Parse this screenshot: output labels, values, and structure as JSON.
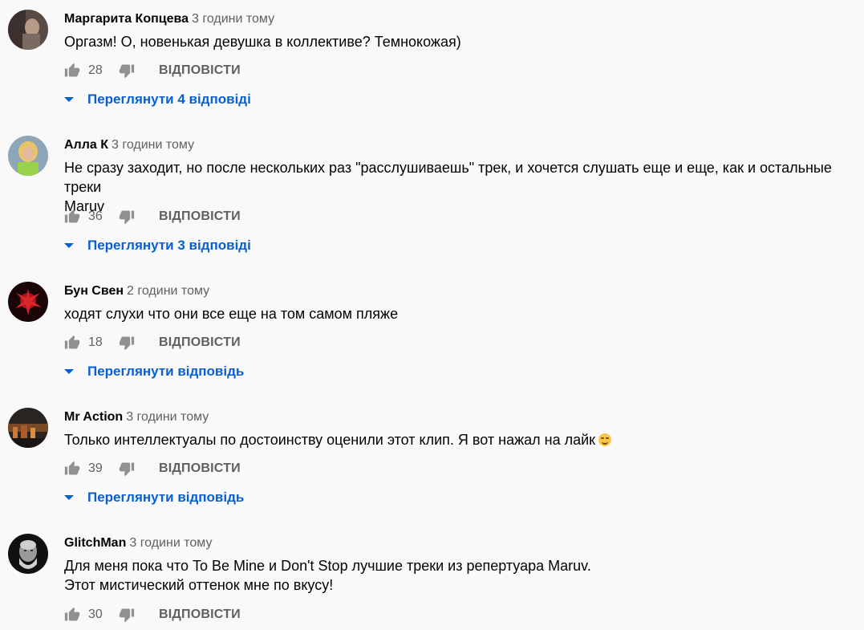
{
  "comments": [
    {
      "author": "Маргарита Копцева",
      "time": "3 години тому",
      "text_lines": [
        "Оргазм! О, новенькая девушка в коллективе? Темнокожая)"
      ],
      "likes": "28",
      "reply_label": "ВІДПОВІСТИ",
      "view_replies": "Переглянути 4 відповіді"
    },
    {
      "author": "Алла К",
      "time": "3 години тому",
      "text_lines": [
        "Не сразу заходит, но после нескольких раз \"расслушиваешь\" трек, и хочется слушать еще и еще, как и остальные треки",
        "Maruv"
      ],
      "likes": "36",
      "reply_label": "ВІДПОВІСТИ",
      "view_replies": "Переглянути 3 відповіді"
    },
    {
      "author": "Бун Свен",
      "time": "2 години тому",
      "text_lines": [
        "ходят слухи что они все еще на том самом пляже"
      ],
      "likes": "18",
      "reply_label": "ВІДПОВІСТИ",
      "view_replies": "Переглянути відповідь"
    },
    {
      "author": "Mr Action",
      "time": "3 години тому",
      "text_lines": [
        "Только интеллектуалы по достоинству оценили этот клип. Я вот нажал на лайк"
      ],
      "likes": "39",
      "reply_label": "ВІДПОВІСТИ",
      "view_replies": "Переглянути відповідь"
    },
    {
      "author": "GlitchMan",
      "time": "3 години тому",
      "text_lines": [
        "Для меня пока что To Be Mine и Don't Stop лучшие треки из репертуара Maruv.",
        "Этот мистический оттенок мне по вкусу!"
      ],
      "likes": "30",
      "reply_label": "ВІДПОВІСТИ",
      "view_replies": ""
    }
  ],
  "icons": {
    "like": "thumb-up-icon",
    "dislike": "thumb-down-icon",
    "expand": "caret-down-icon",
    "emoji": "smirk-emoji-icon"
  },
  "colors": {
    "background": "#f9f9f9",
    "link_blue": "#065fd4",
    "secondary_text": "#606060",
    "primary_text": "#030303"
  }
}
